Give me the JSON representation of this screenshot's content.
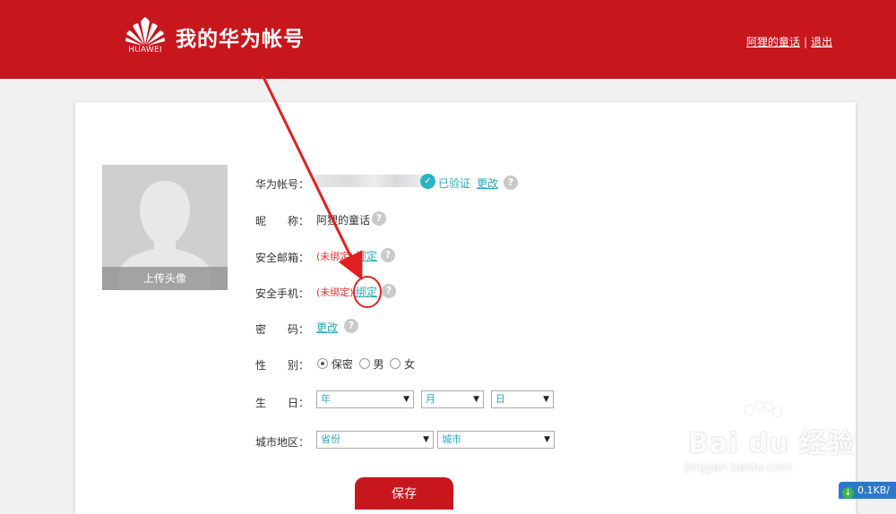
{
  "header": {
    "logo_text": "HUAWEI",
    "title": "我的华为帐号",
    "username_link": "阿狸的童话",
    "separator": "|",
    "logout_link": "退出"
  },
  "avatar": {
    "caption": "上传头像"
  },
  "form": {
    "account": {
      "label": "华为帐号：",
      "verified_icon": "check-icon",
      "verified_text": "已验证",
      "change_link": "更改",
      "help": "?"
    },
    "nickname": {
      "label": "昵　　称：",
      "value": "阿狸的童话",
      "help": "?"
    },
    "email": {
      "label": "安全邮箱：",
      "status": "(未绑定)",
      "bind_link": "绑定",
      "help": "?"
    },
    "phone": {
      "label": "安全手机：",
      "status": "(未绑定)",
      "bind_link": "绑定",
      "help": "?"
    },
    "password": {
      "label": "密　　码：",
      "change_link": "更改",
      "help": "?"
    },
    "gender": {
      "label": "性　　别：",
      "options": [
        "保密",
        "男",
        "女"
      ],
      "selected": "保密"
    },
    "birthday": {
      "label": "生　　日：",
      "year": "年",
      "month": "月",
      "day": "日"
    },
    "region": {
      "label": "城市地区：",
      "province": "省份",
      "city": "城市"
    },
    "save_label": "保存"
  },
  "colors": {
    "brand_red": "#c8161d",
    "link_teal": "#2aa7b8",
    "annotation_red": "#e02020"
  },
  "watermark": {
    "text": "Bai du 经验",
    "url": "jingyan.baidu.com"
  },
  "download_speed": "0.1KB/"
}
